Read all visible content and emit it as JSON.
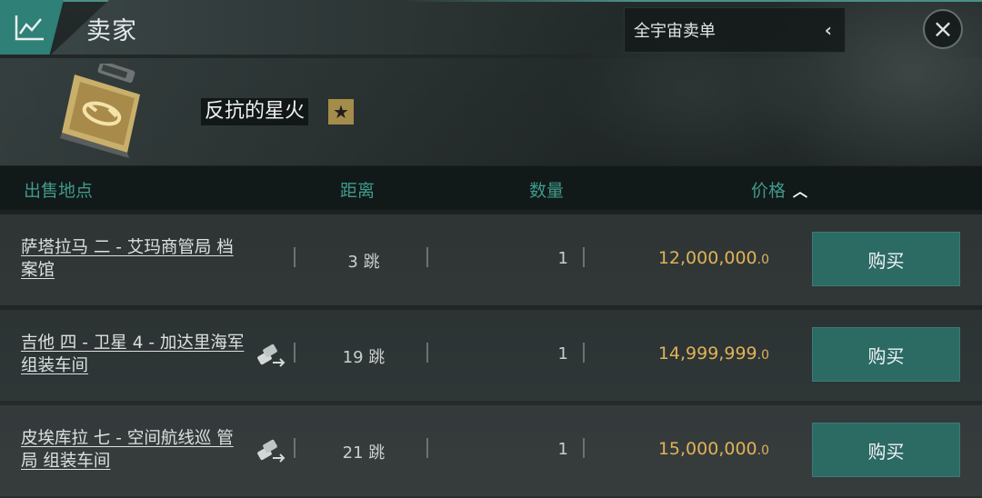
{
  "header": {
    "title": "卖家",
    "region_dropdown": "全宇宙卖单"
  },
  "item": {
    "name": "反抗的星火",
    "badge": "★"
  },
  "table": {
    "columns": {
      "location": "出售地点",
      "distance": "距离",
      "quantity": "数量",
      "price": "价格"
    },
    "sort_indicator": "chevron-up-icon",
    "rows": [
      {
        "location": "萨塔拉马 二 - 艾玛商管局 档案馆",
        "has_hauler_icon": false,
        "distance": "3 跳",
        "quantity": "1",
        "price_main": "12,000,000",
        "price_dec": ".0",
        "buy_label": "购买"
      },
      {
        "location": "吉他 四 - 卫星 4 - 加达里海军 组装车间",
        "has_hauler_icon": true,
        "distance": "19 跳",
        "quantity": "1",
        "price_main": "14,999,999",
        "price_dec": ".0",
        "buy_label": "购买"
      },
      {
        "location": "皮埃库拉 七 - 空间航线巡 管局 组装车间",
        "has_hauler_icon": true,
        "distance": "21 跳",
        "quantity": "1",
        "price_main": "15,000,000",
        "price_dec": ".0",
        "buy_label": "购买"
      }
    ]
  },
  "colors": {
    "accent": "#2f8077",
    "header_text": "#3f9a8d",
    "price": "#e0b257",
    "buy_button": "#2c6a64",
    "star_badge": "#a48c4a"
  }
}
